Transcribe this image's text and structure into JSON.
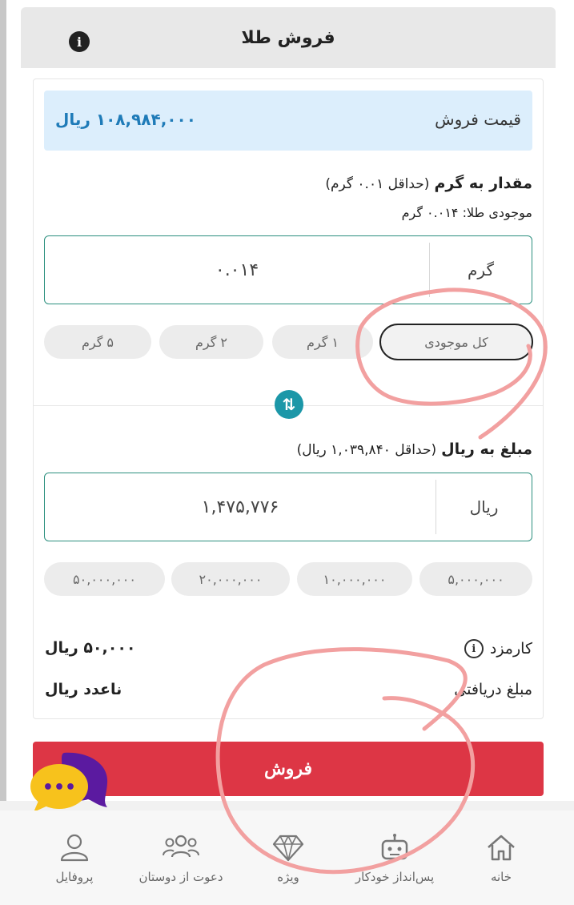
{
  "header": {
    "title": "فروش طلا",
    "info_icon": "i"
  },
  "price": {
    "label": "قیمت فروش",
    "value": "۱۰۸,۹۸۴,۰۰۰ ریال"
  },
  "grams": {
    "title": "مقدار به گرم",
    "hint": "(حداقل ۰.۰۱ گرم)",
    "balance_note": "موجودی طلا: ۰.۰۱۴ گرم",
    "value": "۰.۰۱۴",
    "unit": "گرم",
    "chips": [
      "کل موجودی",
      "۱ گرم",
      "۲ گرم",
      "۵ گرم"
    ],
    "selected_chip": "کل موجودی"
  },
  "swap": {
    "icon": "swap-vertical-icon"
  },
  "rial": {
    "title": "مبلغ به ریال",
    "hint": "(حداقل ۱,۰۳۹,۸۴۰ ریال)",
    "value": "۱,۴۷۵,۷۷۶",
    "unit": "ریال",
    "chips": [
      "۵,۰۰۰,۰۰۰",
      "۱۰,۰۰۰,۰۰۰",
      "۲۰,۰۰۰,۰۰۰",
      "۵۰,۰۰۰,۰۰۰"
    ]
  },
  "summary": {
    "fee_label": "کارمزد",
    "fee_value": "۵۰,۰۰۰ ریال",
    "received_label": "مبلغ دریافتی",
    "received_value": "ناعدد ریال"
  },
  "sell_button": {
    "label": "فروش"
  },
  "chat": {
    "dots": "•••"
  },
  "nav": {
    "items": [
      {
        "id": "home",
        "label": "خانه",
        "icon": "home-icon"
      },
      {
        "id": "auto-save",
        "label": "پس‌انداز خودکار",
        "icon": "robot-icon"
      },
      {
        "id": "special",
        "label": "ویژه",
        "icon": "diamond-icon"
      },
      {
        "id": "invite",
        "label": "دعوت از دوستان",
        "icon": "people-icon"
      },
      {
        "id": "profile",
        "label": "پروفایل",
        "icon": "user-icon"
      }
    ]
  },
  "colors": {
    "accent_teal": "#2b8f7e",
    "swap_button": "#1c97a8",
    "price_bg": "#dceefc",
    "price_text": "#1f7bb8",
    "sell_red": "#dd3645",
    "annotation_red": "#f2a0a0"
  }
}
